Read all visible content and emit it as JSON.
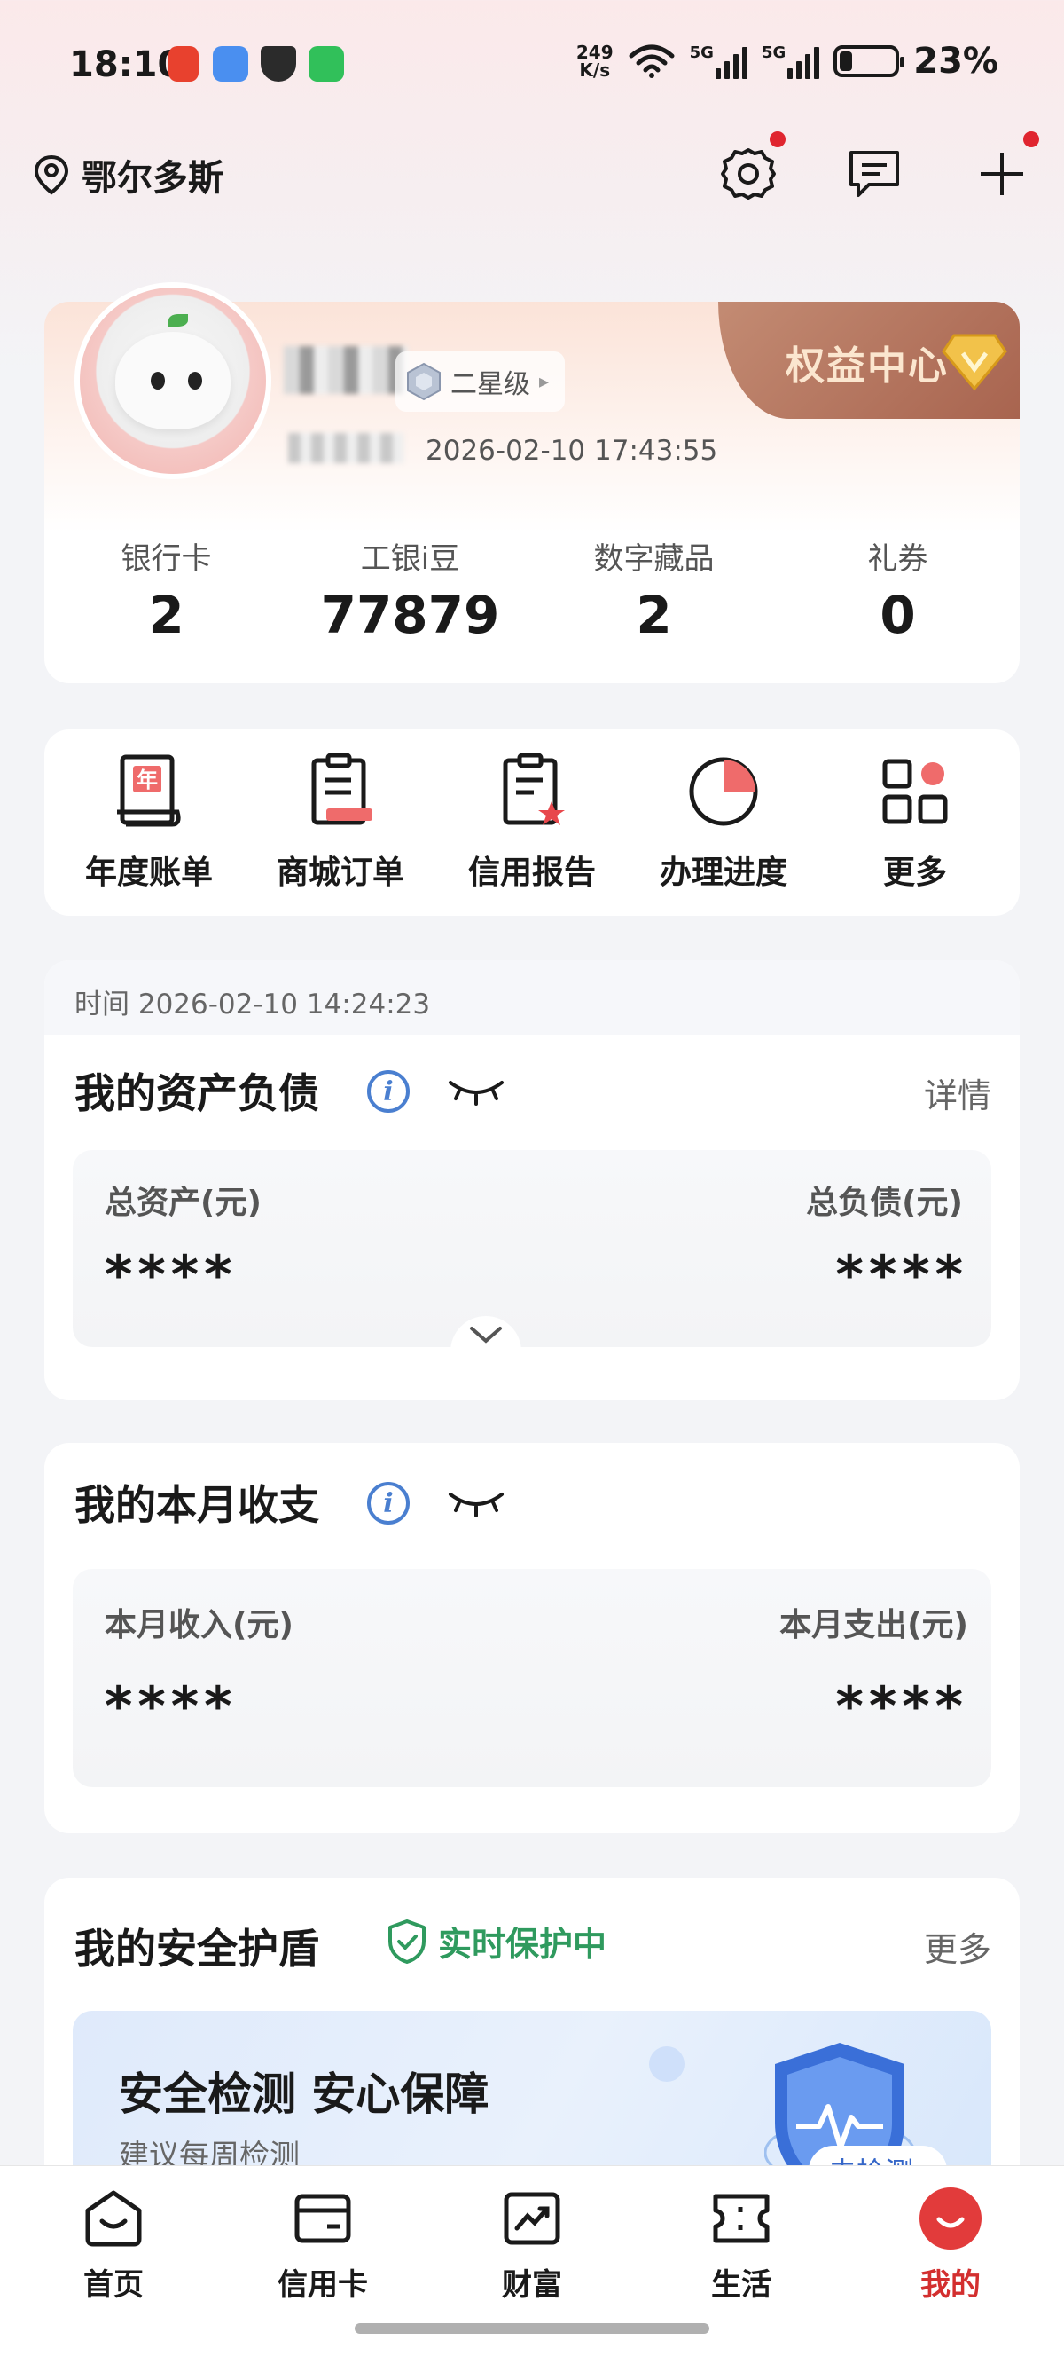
{
  "status_bar": {
    "time": "18:10",
    "net_speed_value": "249",
    "net_speed_unit": "K/s",
    "signal_label_1": "5G",
    "signal_label_2": "5G",
    "battery_percent": "23%",
    "battery_level": 0.23
  },
  "header": {
    "location": "鄂尔多斯"
  },
  "profile": {
    "level_badge": "二星级",
    "benefit_center": "权益中心",
    "last_login_time": "2026-02-10 17:43:55",
    "stats": [
      {
        "label": "银行卡",
        "value": "2"
      },
      {
        "label": "工银i豆",
        "value": "77879"
      },
      {
        "label": "数字藏品",
        "value": "2"
      },
      {
        "label": "礼券",
        "value": "0"
      }
    ]
  },
  "shortcuts": [
    {
      "label": "年度账单",
      "icon": "annual-bill-icon",
      "icon_char": "年"
    },
    {
      "label": "商城订单",
      "icon": "mall-order-icon"
    },
    {
      "label": "信用报告",
      "icon": "credit-report-icon"
    },
    {
      "label": "办理进度",
      "icon": "progress-icon"
    },
    {
      "label": "更多",
      "icon": "more-grid-icon"
    }
  ],
  "assets": {
    "time_label": "时间 2026-02-10 14:24:23",
    "title": "我的资产负债",
    "detail": "详情",
    "total_assets_label": "总资产(元)",
    "total_assets_value": "****",
    "total_liabilities_label": "总负债(元)",
    "total_liabilities_value": "****"
  },
  "monthly": {
    "title": "我的本月收支",
    "income_label": "本月收入(元)",
    "income_value": "****",
    "expense_label": "本月支出(元)",
    "expense_value": "****"
  },
  "shield": {
    "title": "我的安全护盾",
    "status": "实时保护中",
    "more": "更多",
    "banner_title": "安全检测 安心保障",
    "banner_subtitle": "建议每周检测",
    "banner_button": "去检测"
  },
  "bottom_nav": [
    {
      "label": "首页",
      "icon": "home-icon",
      "active": false
    },
    {
      "label": "信用卡",
      "icon": "credit-card-icon",
      "active": false
    },
    {
      "label": "财富",
      "icon": "wealth-icon",
      "active": false
    },
    {
      "label": "生活",
      "icon": "life-ticket-icon",
      "active": false
    },
    {
      "label": "我的",
      "icon": "mine-icon",
      "active": true
    }
  ],
  "colors": {
    "brand_red": "#d32f2f",
    "protect_green": "#2f9a5e",
    "info_blue": "#4a7fd0"
  }
}
